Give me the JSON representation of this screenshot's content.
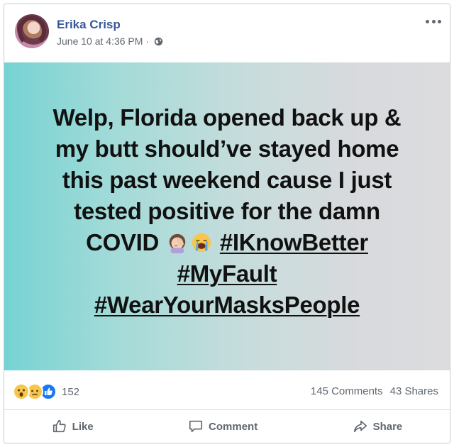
{
  "post": {
    "author": "Erika Crisp",
    "timestamp": "June 10 at 4:36 PM",
    "separator": "·",
    "privacy_icon": "globe-icon",
    "more_icon": "more-options-icon",
    "text_lines": [
      "Welp, Florida opened back up &",
      "my butt should’ve stayed home",
      "this past weekend cause I just",
      "tested positive for the damn",
      "COVID"
    ],
    "emojis": [
      "woman-facepalming-emoji",
      "loudly-crying-face-emoji"
    ],
    "hashtags": [
      "#IKnowBetter",
      "#MyFault",
      "#WearYourMasksPeople"
    ],
    "background_gradient": [
      "#76d3d3",
      "#dcdcde"
    ]
  },
  "stats": {
    "reaction_icons": [
      "wow-reaction-icon",
      "sad-reaction-icon",
      "like-reaction-icon"
    ],
    "reaction_count": "152",
    "comments": "145 Comments",
    "shares": "43 Shares"
  },
  "actions": {
    "like": "Like",
    "comment": "Comment",
    "share": "Share"
  },
  "colors": {
    "name_link": "#385898",
    "secondary_text": "#606770",
    "like_blue": "#1877f2"
  }
}
